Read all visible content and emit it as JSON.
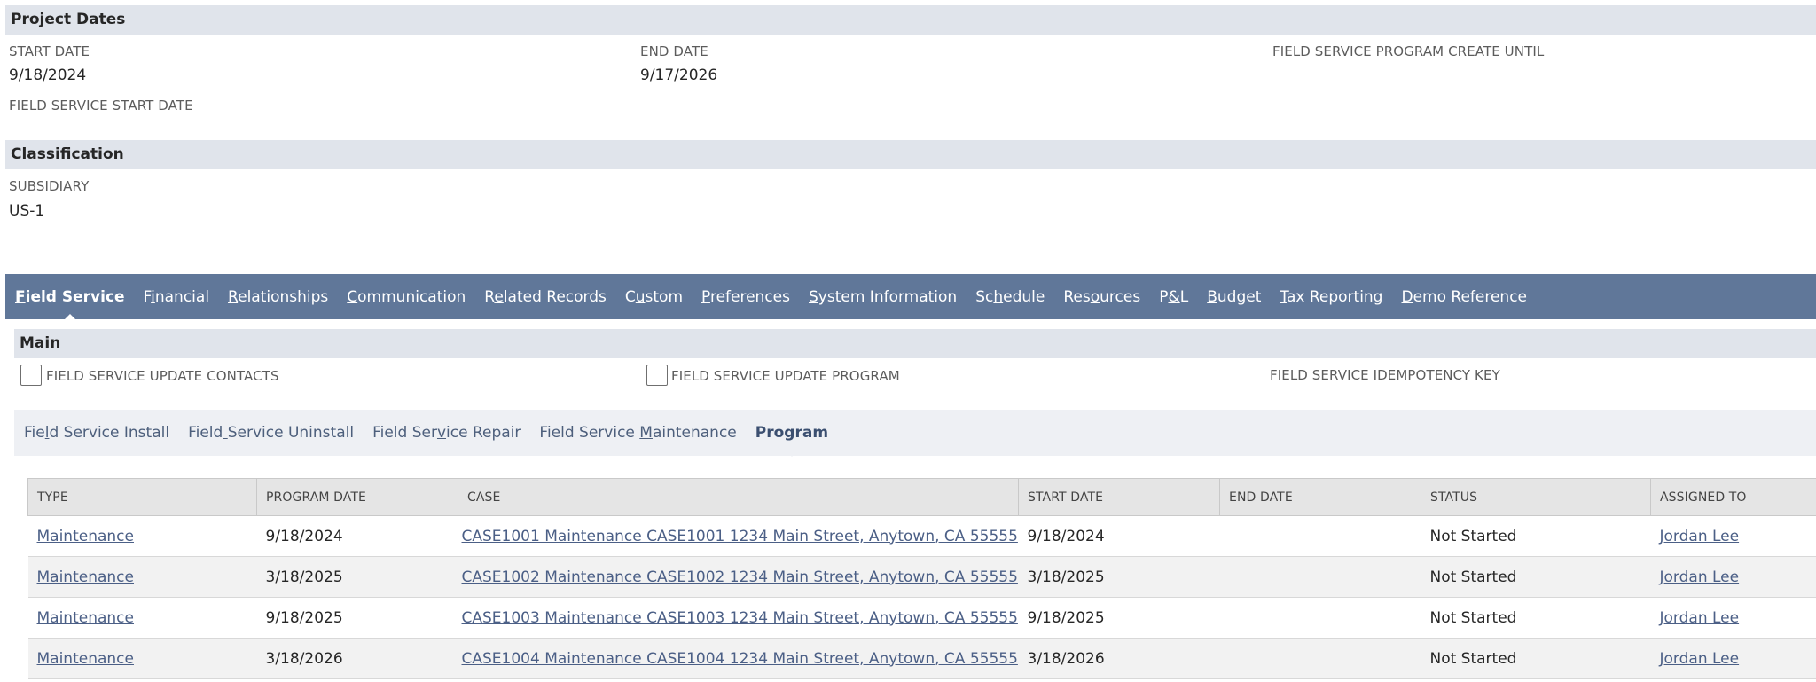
{
  "project_dates": {
    "header": "Project Dates",
    "start_date_label": "START DATE",
    "start_date_value": "9/18/2024",
    "end_date_label": "END DATE",
    "end_date_value": "9/17/2026",
    "create_until_label": "FIELD SERVICE PROGRAM CREATE UNTIL",
    "fs_start_label": "FIELD SERVICE START DATE"
  },
  "classification": {
    "header": "Classification",
    "subsidiary_label": "SUBSIDIARY",
    "subsidiary_value": "US-1"
  },
  "tabs": [
    {
      "pre": "",
      "u": "F",
      "post": "ield Service"
    },
    {
      "pre": "F",
      "u": "i",
      "post": "nancial"
    },
    {
      "pre": "",
      "u": "R",
      "post": "elationships"
    },
    {
      "pre": "",
      "u": "C",
      "post": "ommunication"
    },
    {
      "pre": "R",
      "u": "e",
      "post": "lated Records"
    },
    {
      "pre": "C",
      "u": "u",
      "post": "stom"
    },
    {
      "pre": "",
      "u": "P",
      "post": "references"
    },
    {
      "pre": "",
      "u": "S",
      "post": "ystem Information"
    },
    {
      "pre": "Sc",
      "u": "h",
      "post": "edule"
    },
    {
      "pre": "Res",
      "u": "o",
      "post": "urces"
    },
    {
      "pre": "P",
      "u": "&",
      "post": "L"
    },
    {
      "pre": "",
      "u": "B",
      "post": "udget"
    },
    {
      "pre": "",
      "u": "T",
      "post": "ax Reporting"
    },
    {
      "pre": "",
      "u": "D",
      "post": "emo Reference"
    }
  ],
  "main": {
    "header": "Main",
    "update_contacts_label": "FIELD SERVICE UPDATE CONTACTS",
    "update_program_label": "FIELD SERVICE UPDATE PROGRAM",
    "idempotency_label": "FIELD SERVICE IDEMPOTENCY KEY"
  },
  "subtabs": [
    {
      "pre": "Fie",
      "u": "l",
      "post": "d Service Install"
    },
    {
      "pre": "Field",
      "u": " ",
      "post": "Service Uninstall"
    },
    {
      "pre": "Field Ser",
      "u": "v",
      "post": "ice Repair"
    },
    {
      "pre": "Field Service ",
      "u": "M",
      "post": "aintenance"
    },
    {
      "pre": "Program",
      "u": "",
      "post": ""
    }
  ],
  "table": {
    "headers": [
      "TYPE",
      "PROGRAM DATE",
      "CASE",
      "START DATE",
      "END DATE",
      "STATUS",
      "ASSIGNED TO"
    ],
    "rows": [
      {
        "type": "Maintenance",
        "program_date": "9/18/2024",
        "case": "CASE1001 Maintenance CASE1001 1234 Main Street, Anytown, CA 55555",
        "start_date": "9/18/2024",
        "end_date": "",
        "status": "Not Started",
        "assigned_to": "Jordan Lee"
      },
      {
        "type": "Maintenance",
        "program_date": "3/18/2025",
        "case": "CASE1002 Maintenance CASE1002 1234 Main Street, Anytown, CA 55555",
        "start_date": "3/18/2025",
        "end_date": "",
        "status": "Not Started",
        "assigned_to": "Jordan Lee"
      },
      {
        "type": "Maintenance",
        "program_date": "9/18/2025",
        "case": "CASE1003 Maintenance CASE1003 1234 Main Street, Anytown, CA 55555",
        "start_date": "9/18/2025",
        "end_date": "",
        "status": "Not Started",
        "assigned_to": "Jordan Lee"
      },
      {
        "type": "Maintenance",
        "program_date": "3/18/2026",
        "case": "CASE1004 Maintenance CASE1004 1234 Main Street, Anytown, CA 55555",
        "start_date": "3/18/2026",
        "end_date": "",
        "status": "Not Started",
        "assigned_to": "Jordan Lee"
      }
    ]
  },
  "colors": {
    "tab_bar": "#607799",
    "section_header": "#e0e4eb",
    "link": "#4b5f86"
  }
}
